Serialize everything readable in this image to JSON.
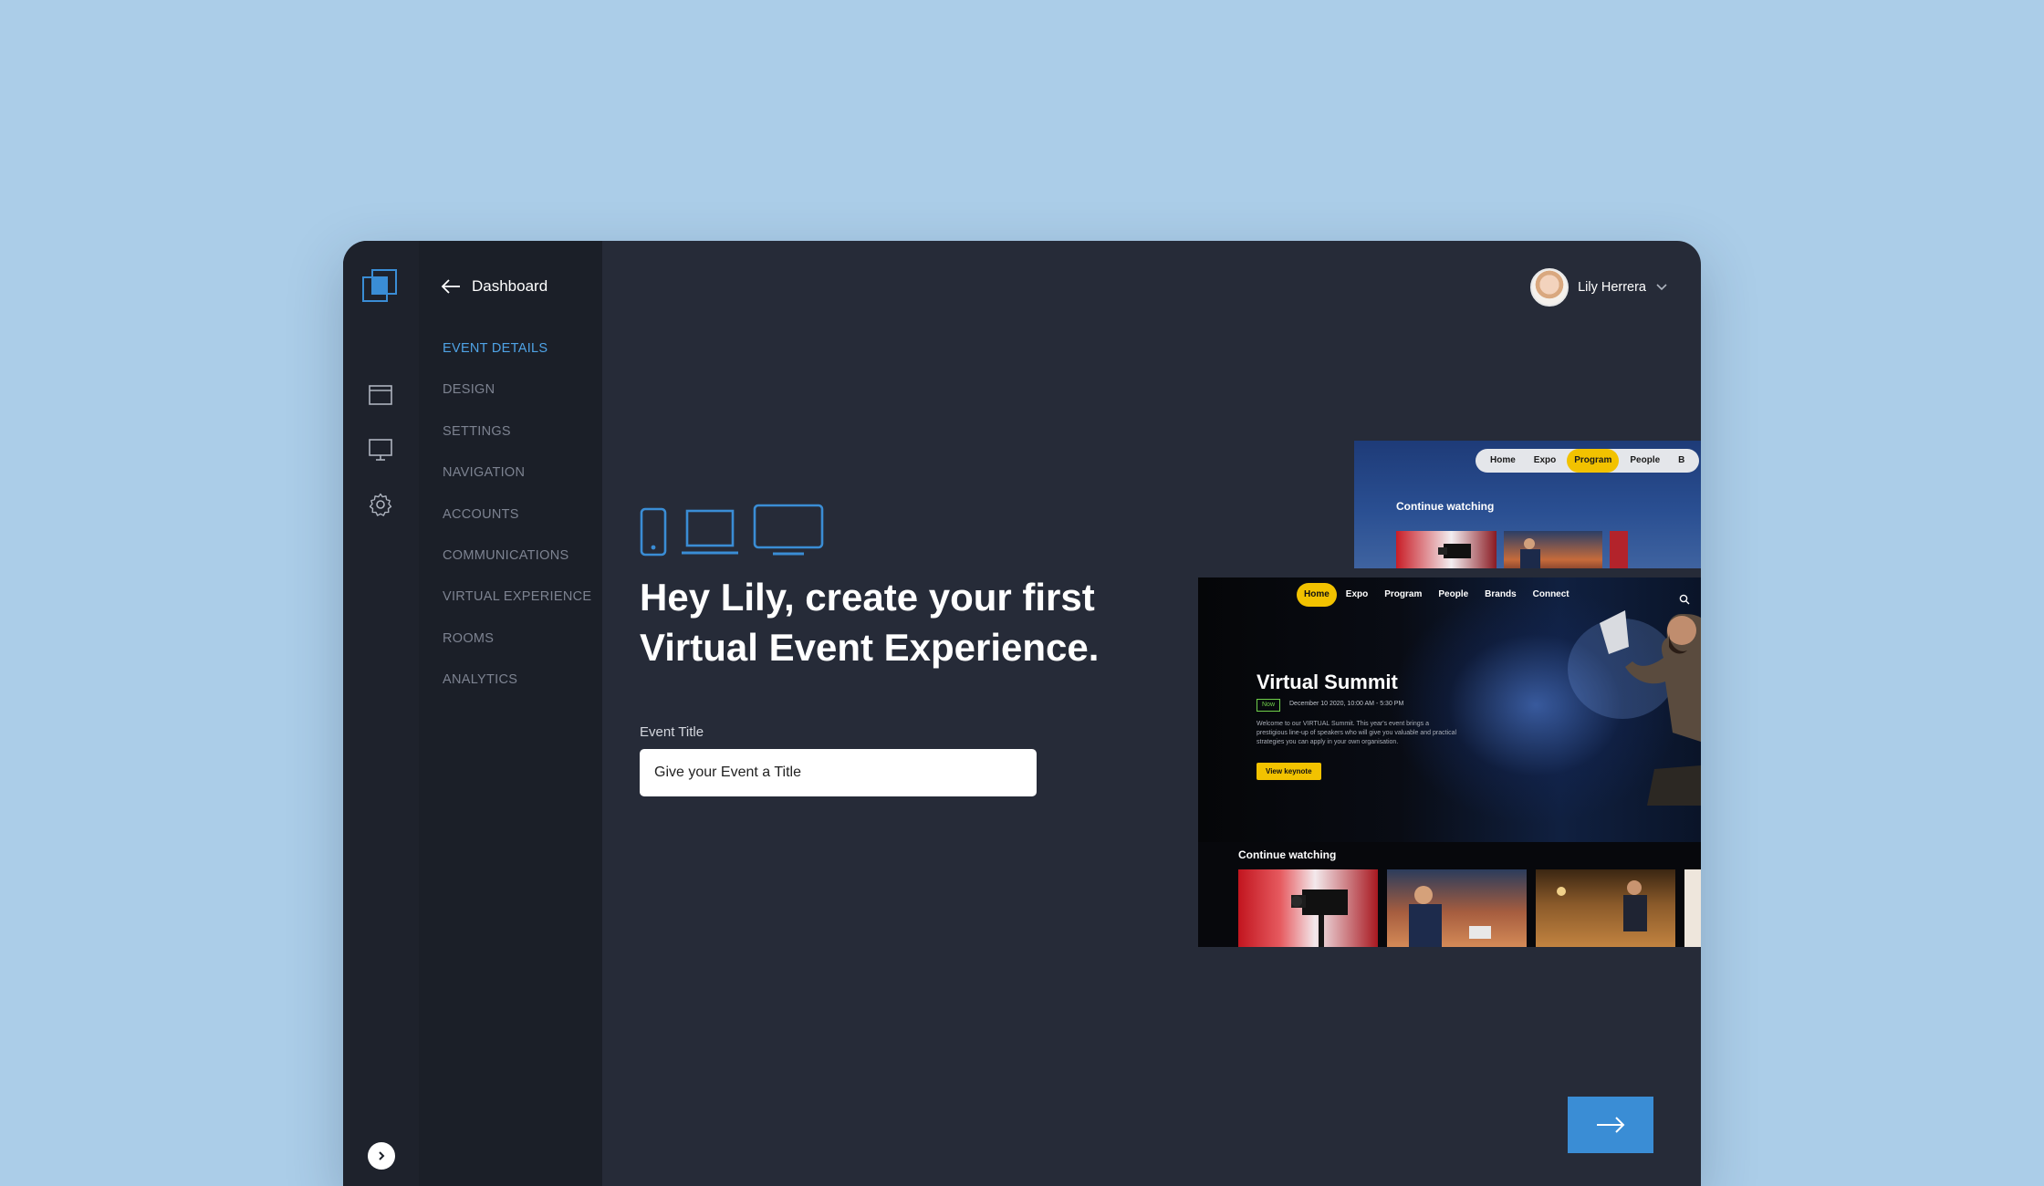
{
  "sidebar": {
    "back_label": "Dashboard",
    "menu": [
      {
        "label": "EVENT DETAILS",
        "active": true
      },
      {
        "label": "DESIGN",
        "active": false
      },
      {
        "label": "SETTINGS",
        "active": false
      },
      {
        "label": "NAVIGATION",
        "active": false
      },
      {
        "label": "ACCOUNTS",
        "active": false
      },
      {
        "label": "COMMUNICATIONS",
        "active": false
      },
      {
        "label": "VIRTUAL EXPERIENCE",
        "active": false
      },
      {
        "label": "ROOMS",
        "active": false
      },
      {
        "label": "ANALYTICS",
        "active": false
      }
    ],
    "rail_icons": [
      "layout-icon",
      "monitor-icon",
      "gear-icon"
    ]
  },
  "header": {
    "user_name": "Lily Herrera"
  },
  "main": {
    "headline": "Hey Lily, create your first Virtual Event Experience.",
    "devices": [
      "phone-icon",
      "laptop-icon",
      "monitor-icon"
    ],
    "event_title_label": "Event Title",
    "event_title_placeholder": "Give your Event a Title",
    "event_title_value": ""
  },
  "preview_back": {
    "nav": [
      "Home",
      "Expo",
      "Program",
      "People",
      "B"
    ],
    "active_nav": "Program",
    "continue_watching": "Continue watching"
  },
  "preview_front": {
    "nav": [
      "Home",
      "Expo",
      "Program",
      "People",
      "Brands",
      "Connect"
    ],
    "active_nav": "Home",
    "title": "Virtual Summit",
    "badge": "Now",
    "date": "December 10 2020, 10:00 AM - 5:30 PM",
    "description": "Welcome to our VIRTUAL Summit. This year's event brings a prestigious line-up of speakers who will give you valuable and practical strategies you can apply in your own organisation.",
    "cta": "View keynote",
    "continue_watching": "Continue watching"
  },
  "colors": {
    "background": "#abcde8",
    "window": "#262b38",
    "sidebar": "#1b1f28",
    "rail": "#1e222c",
    "accent": "#4fa3e6",
    "button": "#3a8dd5",
    "highlight": "#f2c200"
  }
}
